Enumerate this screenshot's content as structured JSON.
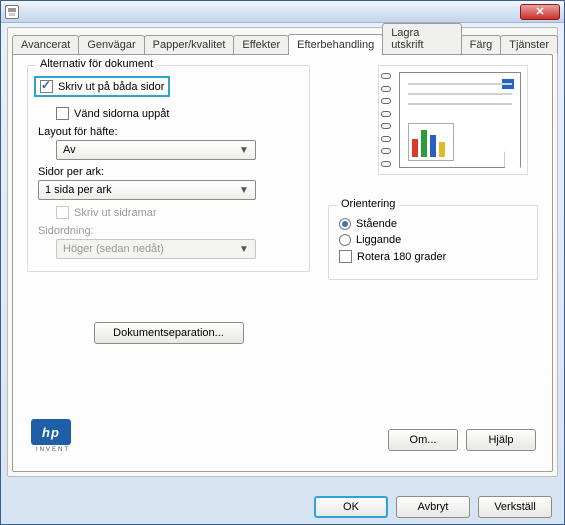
{
  "titlebar": {
    "close_glyph": "✕"
  },
  "tabs": [
    {
      "label": "Avancerat"
    },
    {
      "label": "Genvägar"
    },
    {
      "label": "Papper/kvalitet"
    },
    {
      "label": "Effekter"
    },
    {
      "label": "Efterbehandling"
    },
    {
      "label": "Lagra utskrift"
    },
    {
      "label": "Färg"
    },
    {
      "label": "Tjänster"
    }
  ],
  "doc_options": {
    "title": "Alternativ för dokument",
    "both_sides": "Skriv ut på båda sidor",
    "flip_up": "Vänd sidorna uppåt",
    "booklet_label": "Layout för häfte:",
    "booklet_value": "Av",
    "pages_per_sheet_label": "Sidor per ark:",
    "pages_per_sheet_value": "1 sida per ark",
    "print_borders": "Skriv ut sidramar",
    "page_order_label": "Sidordning:",
    "page_order_value": "Höger (sedan nedåt)"
  },
  "doc_sep_button": "Dokumentseparation...",
  "orientation": {
    "title": "Orientering",
    "portrait": "Stående",
    "landscape": "Liggande",
    "rotate": "Rotera 180 grader"
  },
  "logo": {
    "text": "hp",
    "sub": "INVENT"
  },
  "footer": {
    "about": "Om...",
    "help": "Hjälp"
  },
  "dialog": {
    "ok": "OK",
    "cancel": "Avbryt",
    "apply": "Verkställ"
  },
  "colors": {
    "bars": [
      "#d83a2b",
      "#2e9a3a",
      "#2b5fc2",
      "#e2b82a"
    ]
  }
}
